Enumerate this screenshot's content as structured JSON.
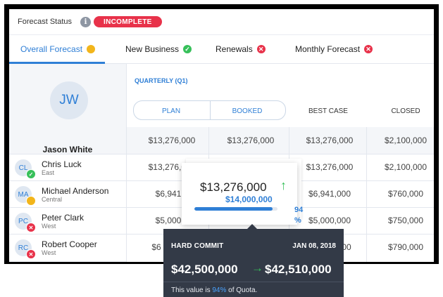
{
  "status": {
    "label": "Forecast Status",
    "info_icon": "i",
    "badge": "INCOMPLETE"
  },
  "tabs": [
    {
      "label": "Overall Forecast",
      "indicator": "yellow",
      "icon": "",
      "active": true
    },
    {
      "label": "New Business",
      "indicator": "green",
      "icon": "✓"
    },
    {
      "label": "Renewals",
      "indicator": "red",
      "icon": "✕"
    },
    {
      "label": "Monthly Forecast",
      "indicator": "red",
      "icon": "✕"
    }
  ],
  "owner": {
    "initials": "JW",
    "name": "Jason White"
  },
  "period": "QUARTERLY (Q1)",
  "columns": [
    "PLAN",
    "BOOKED",
    "BEST CASE",
    "CLOSED"
  ],
  "total_row": [
    "$13,276,000",
    "$13,276,000",
    "$13,276,000",
    "$2,100,000"
  ],
  "reps": [
    {
      "initials": "CL",
      "name": "Chris Luck",
      "region": "East",
      "status": "green",
      "status_icon": "✓",
      "values": [
        "$13,276,000",
        "",
        "$13,276,000",
        "$2,100,000"
      ]
    },
    {
      "initials": "MA",
      "name": "Michael Anderson",
      "region": "Central",
      "status": "yellow",
      "status_icon": "",
      "values": [
        "$6,941,0",
        "",
        "$6,941,000",
        "$760,000"
      ]
    },
    {
      "initials": "PC",
      "name": "Peter Clark",
      "region": "West",
      "status": "red",
      "status_icon": "✕",
      "values": [
        "$5,000,0",
        "",
        "$5,000,000",
        "$750,000"
      ]
    },
    {
      "initials": "RC",
      "name": "Robert Cooper",
      "region": "West",
      "status": "red",
      "status_icon": "✕",
      "values": [
        "$6",
        "",
        "00",
        "$790,000"
      ]
    }
  ],
  "popover": {
    "value": "$13,276,000",
    "trend_icon": "↑",
    "target": "$14,000,000",
    "progress": 0.94,
    "percent": "94",
    "percent_sign": "%"
  },
  "tooltip": {
    "label": "HARD COMMIT",
    "date": "JAN 08, 2018",
    "from": "$42,500,000",
    "arrow": "→",
    "to": "$42,510,000",
    "note_prefix": "This value is ",
    "note_pct": "94%",
    "note_suffix": " of Quota."
  },
  "colors": {
    "accent": "#2f7fd6",
    "danger": "#e8324a",
    "success": "#37c05a",
    "warning": "#f2b51b",
    "tooltip_bg": "#333a47"
  }
}
